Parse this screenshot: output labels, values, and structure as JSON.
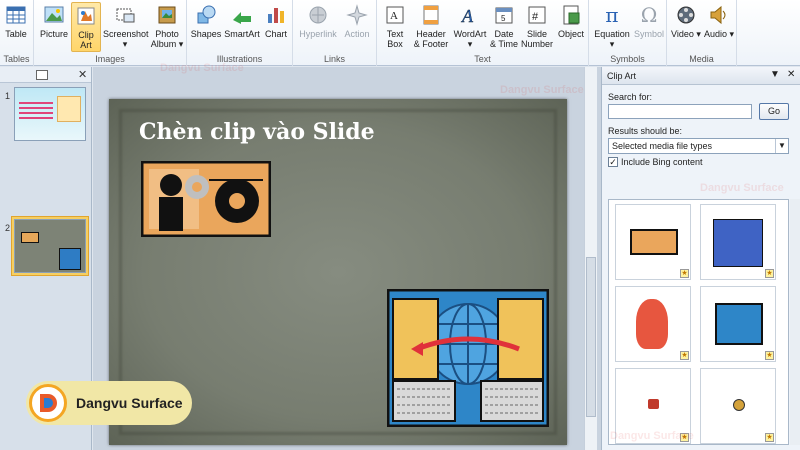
{
  "ribbon": {
    "groups": {
      "tables": "Tables",
      "images": "Images",
      "illustrations": "Illustrations",
      "links": "Links",
      "text": "Text",
      "symbols": "Symbols",
      "media": "Media"
    },
    "buttons": {
      "table": "Table",
      "picture": "Picture",
      "clip_art_1": "Clip",
      "clip_art_2": "Art",
      "screenshot": "Screenshot",
      "photo_album_1": "Photo",
      "photo_album_2": "Album",
      "shapes": "Shapes",
      "smartart": "SmartArt",
      "chart": "Chart",
      "hyperlink": "Hyperlink",
      "action": "Action",
      "text_box_1": "Text",
      "text_box_2": "Box",
      "header_footer_1": "Header",
      "header_footer_2": "& Footer",
      "wordart": "WordArt",
      "date_time_1": "Date",
      "date_time_2": "& Time",
      "slide_number_1": "Slide",
      "slide_number_2": "Number",
      "object": "Object",
      "equation": "Equation",
      "symbol": "Symbol",
      "video": "Video",
      "audio": "Audio"
    }
  },
  "slides_pane": {
    "thumb1_number": "1",
    "thumb2_number": "2"
  },
  "slide": {
    "title": "Chèn clip vào Slide"
  },
  "clip_art": {
    "title": "Clip Art",
    "search_label": "Search for:",
    "search_value": "",
    "go_label": "Go",
    "results_label": "Results should be:",
    "results_value": "Selected media file types",
    "include_bing": "Include Bing content"
  },
  "logo": {
    "text": "Dangvu Surface"
  },
  "watermark": "Dangvu Surface"
}
